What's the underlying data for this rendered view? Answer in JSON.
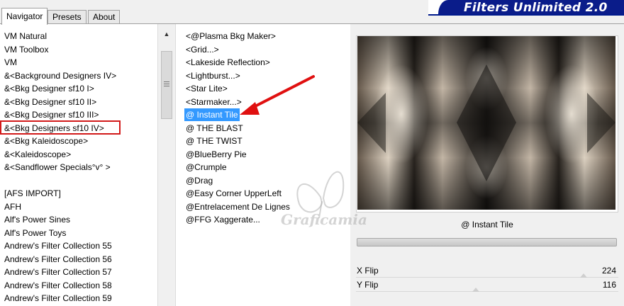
{
  "tabs": [
    "Navigator",
    "Presets",
    "About"
  ],
  "banner": {
    "title": "Filters Unlimited 2.0"
  },
  "categories": [
    "VM Natural",
    "VM Toolbox",
    "VM",
    "&<Background Designers IV>",
    "&<Bkg Designer sf10 I>",
    "&<Bkg Designer sf10 II>",
    "&<Bkg Designer sf10 III>",
    "&<Bkg Designers sf10 IV>",
    "&<Bkg Kaleidoscope>",
    "&<Kaleidoscope>",
    "&<Sandflower Specials°v° >",
    "",
    "[AFS IMPORT]",
    "AFH",
    "Alf's Power Sines",
    "Alf's Power Toys",
    "Andrew's Filter Collection 55",
    "Andrew's Filter Collection 56",
    "Andrew's Filter Collection 57",
    "Andrew's Filter Collection 58",
    "Andrew's Filter Collection 59"
  ],
  "filters": [
    "<@Plasma Bkg Maker>",
    "<Grid...>",
    "<Lakeside Reflection>",
    "<Lightburst...>",
    "<Star Lite>",
    "<Starmaker...>",
    "@ Instant Tile",
    "@ THE BLAST",
    "@ THE TWIST",
    "@BlueBerry Pie",
    "@Crumple",
    "@Drag",
    "@Easy Corner UpperLeft",
    "@Entrelacement De Lignes",
    "@FFG Xaggerate..."
  ],
  "selected_filter": "@ Instant Tile",
  "highlighted_category": "&<Bkg Designers sf10 IV>",
  "preview": {
    "filter_name": "@ Instant Tile",
    "sliders": [
      {
        "label": "X Flip",
        "value": "224",
        "fraction": 0.878
      },
      {
        "label": "Y Flip",
        "value": "116",
        "fraction": 0.455
      }
    ]
  },
  "watermark": "Graficamia",
  "colors": {
    "selection": "#3399ff",
    "highlight_box": "#d21a1a",
    "banner": "#0a1c8a",
    "arrow": "#e01010"
  }
}
